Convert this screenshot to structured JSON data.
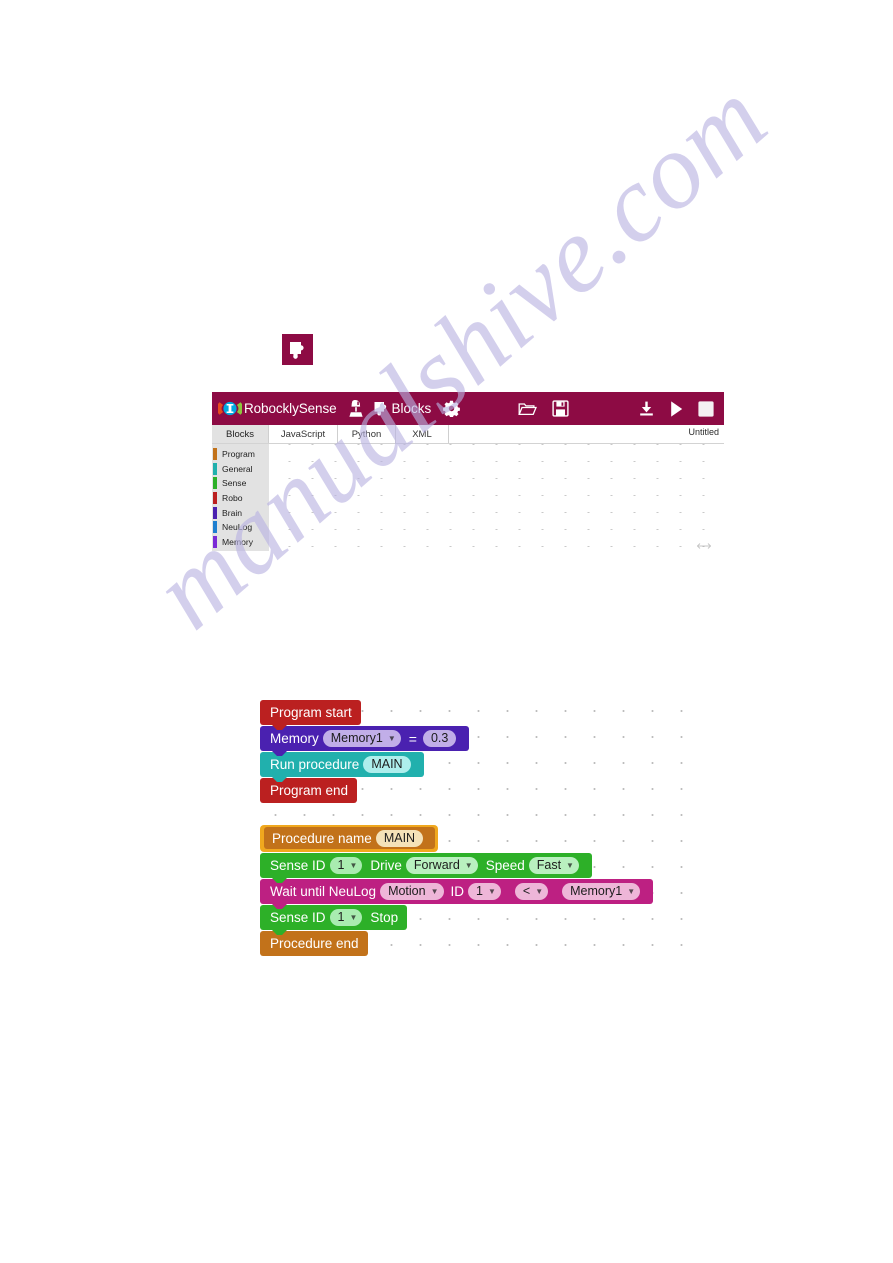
{
  "page": {
    "watermark": "manualshive.com"
  },
  "standalone_icon": {
    "name": "blocks-puzzle-icon",
    "color": "#8d0b44"
  },
  "app": {
    "toolbar": {
      "brand": "RobocklySense",
      "blocks_label": "Blocks",
      "icons": [
        "robot-icon",
        "puzzle-icon",
        "gear-icon",
        "folder-open-icon",
        "save-icon",
        "download-icon",
        "play-icon",
        "stop-icon"
      ],
      "background": "#8d0b44"
    },
    "document_title": "Untitled",
    "tabs": [
      {
        "label": "Blocks",
        "selected": true
      },
      {
        "label": "JavaScript",
        "selected": false
      },
      {
        "label": "Python",
        "selected": false
      },
      {
        "label": "XML",
        "selected": false
      }
    ],
    "palette": {
      "categories": [
        {
          "label": "Program",
          "color": "#c2721a"
        },
        {
          "label": "General",
          "color": "#21b0ad"
        },
        {
          "label": "Sense",
          "color": "#2db028"
        },
        {
          "label": "Robo",
          "color": "#bb2020"
        },
        {
          "label": "Brain",
          "color": "#4a21b0"
        },
        {
          "label": "NeuLog",
          "color": "#1f7fd0"
        },
        {
          "label": "Memory",
          "color": "#7a2ad6"
        }
      ]
    }
  },
  "program": {
    "main_stack": {
      "start_label": "Program start",
      "memory_row": {
        "keyword": "Memory",
        "variable": "Memory1",
        "operator": "=",
        "value": "0.3"
      },
      "run_procedure": {
        "keyword": "Run procedure",
        "procedure": "MAIN"
      },
      "end_label": "Program end"
    },
    "procedure_stack": {
      "definition": {
        "keyword": "Procedure name",
        "name": "MAIN"
      },
      "drive_row": {
        "sense_label": "Sense ID",
        "sense_id": "1",
        "drive_label": "Drive",
        "direction": "Forward",
        "speed_label": "Speed",
        "speed": "Fast"
      },
      "wait_row": {
        "keyword": "Wait until NeuLog",
        "sensor": "Motion",
        "id_label": "ID",
        "id_value": "1",
        "comparator": "<",
        "compare_to": "Memory1"
      },
      "stop_row": {
        "sense_label": "Sense ID",
        "sense_id": "1",
        "action": "Stop"
      },
      "end_label": "Procedure end"
    }
  }
}
